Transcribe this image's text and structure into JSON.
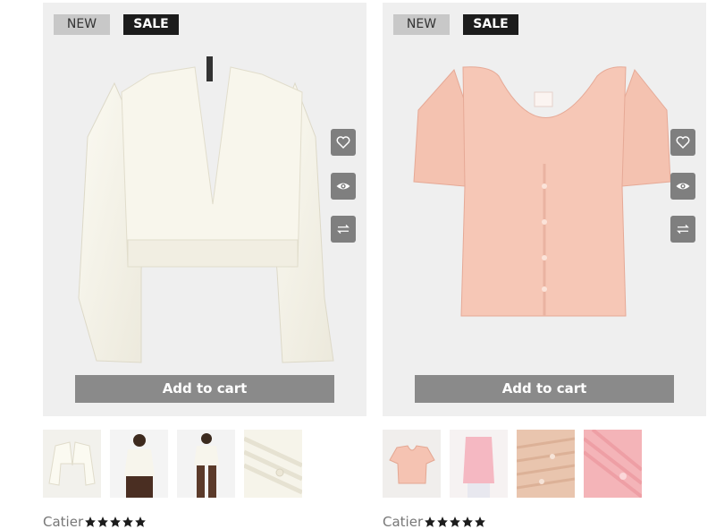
{
  "products": [
    {
      "badge_new": "NEW",
      "badge_sale": "SALE",
      "add_to_cart": "Add to cart",
      "brand": "Catier",
      "rating": 5,
      "image_desc": "white-cropped-v-neck-cardigan",
      "thumbnails": [
        "cardigan-flat",
        "model-front-brown-pants",
        "model-front-standing",
        "knit-detail"
      ]
    },
    {
      "badge_new": "NEW",
      "badge_sale": "SALE",
      "add_to_cart": "Add to cart",
      "brand": "Catier",
      "rating": 5,
      "image_desc": "pink-short-sleeve-button-top",
      "thumbnails": [
        "pink-top-flat",
        "model-pink-top",
        "ribbed-detail",
        "pink-close-up"
      ]
    }
  ],
  "icons": {
    "wishlist": "heart-icon",
    "quickview": "eye-icon",
    "compare": "compare-arrows-icon",
    "star": "star-icon"
  },
  "colors": {
    "badge_sale_bg": "#1c1c1c",
    "badge_new_bg": "#c8c8c8",
    "action_bg": "#7f7f7f",
    "cart_bg": "#8a8a8a"
  }
}
